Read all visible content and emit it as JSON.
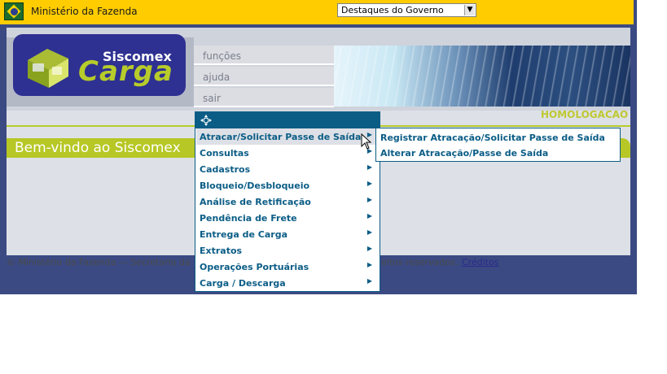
{
  "topbar": {
    "ministry": "Ministério da Fazenda",
    "destaques_select": "Destaques do Governo"
  },
  "logo": {
    "line1": "Siscomex",
    "line2": "Carga"
  },
  "nav": [
    {
      "label": "funções"
    },
    {
      "label": "ajuda"
    },
    {
      "label": "sair"
    }
  ],
  "environment_label": "HOMOLOGACAO",
  "welcome": "Bem-vindo ao Siscomex",
  "footer": {
    "text_left": "© Ministério da Fazenda — Secretaria da",
    "text_right": "eitos reservados.",
    "link": "Créditos"
  },
  "menu": {
    "items": [
      {
        "label": "Atracar/Solicitar Passe de Saída"
      },
      {
        "label": "Consultas"
      },
      {
        "label": "Cadastros"
      },
      {
        "label": "Bloqueio/Desbloqueio"
      },
      {
        "label": "Análise de Retificação"
      },
      {
        "label": "Pendência de Frete"
      },
      {
        "label": "Entrega de Carga"
      },
      {
        "label": "Extratos"
      },
      {
        "label": "Operações Portuárias"
      },
      {
        "label": "Carga / Descarga"
      }
    ],
    "submenu": [
      {
        "label": "Registrar Atracação/Solicitar Passe de Saída"
      },
      {
        "label": "Alterar Atracação/Passe de Saída"
      }
    ]
  },
  "colors": {
    "accent_yellow": "#ffcc00",
    "menu_blue": "#0b5d86",
    "lime": "#b7c725",
    "frame_navy": "#3b4a82"
  }
}
